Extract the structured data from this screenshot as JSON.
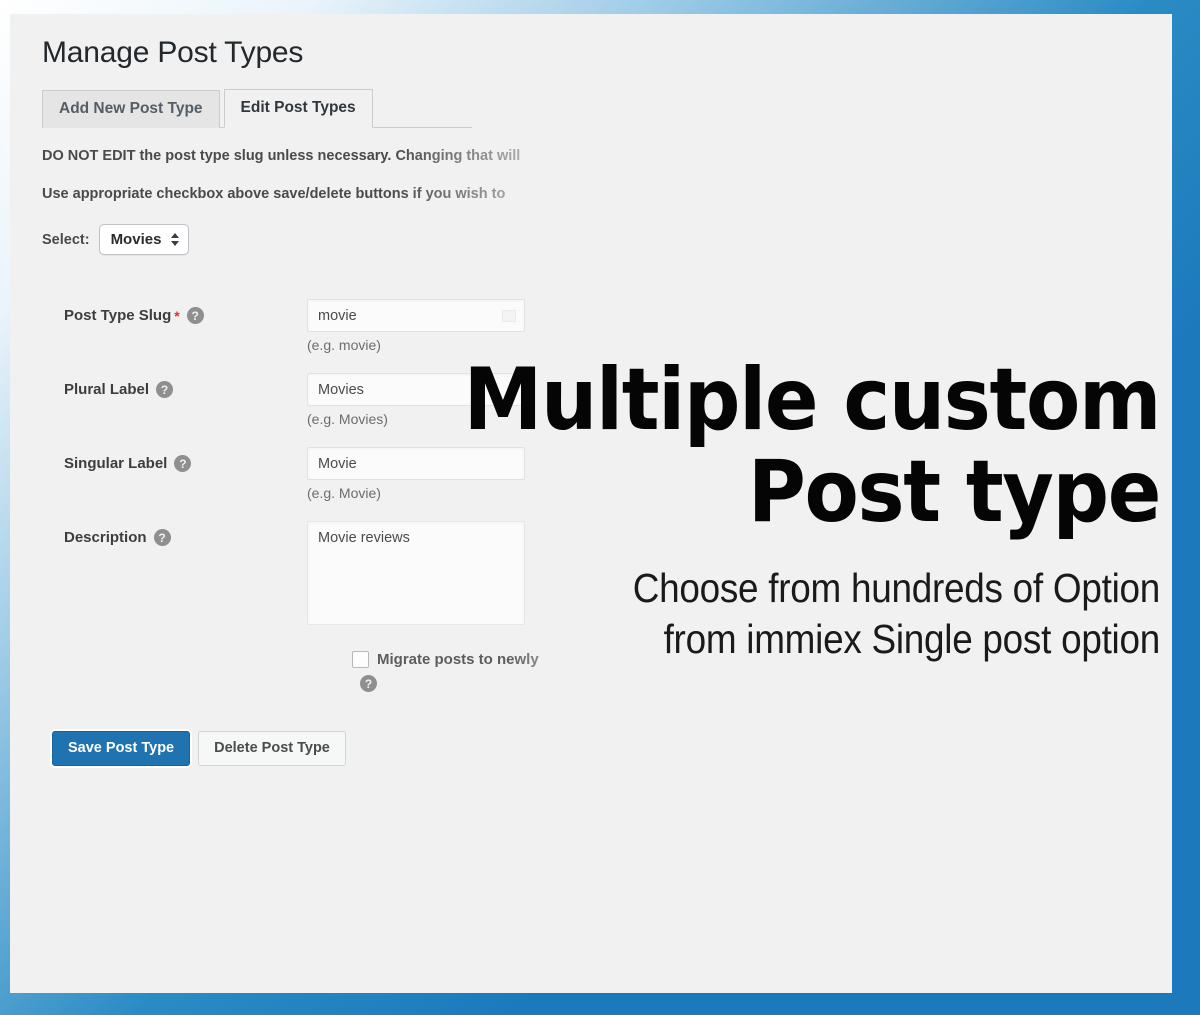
{
  "admin": {
    "page_title": "Manage Post Types",
    "tabs": [
      {
        "label": "Add New Post Type",
        "active": false
      },
      {
        "label": "Edit Post Types",
        "active": true
      }
    ],
    "notices": [
      "DO NOT EDIT the post type slug unless necessary. Changing that will",
      "Use appropriate checkbox above save/delete buttons if you wish to"
    ],
    "select_row": {
      "label": "Select:",
      "value": "Movies",
      "options": [
        "Movies"
      ]
    },
    "fields": [
      {
        "label": "Post Type Slug",
        "required": true,
        "required_marker": "*",
        "help": "?",
        "value": "movie",
        "hint": "(e.g. movie)",
        "type": "text"
      },
      {
        "label": "Plural Label",
        "required": false,
        "help": "?",
        "value": "Movies",
        "hint": "(e.g. Movies)",
        "type": "text"
      },
      {
        "label": "Singular Label",
        "required": false,
        "help": "?",
        "value": "Movie",
        "hint": "(e.g. Movie)",
        "type": "text"
      },
      {
        "label": "Description",
        "required": false,
        "help": "?",
        "value": "Movie reviews",
        "hint": "",
        "type": "textarea"
      }
    ],
    "migrate": {
      "label": "Migrate posts to newly",
      "checked": false,
      "help": "?"
    },
    "buttons": {
      "save": "Save Post Type",
      "delete": "Delete Post Type"
    }
  },
  "marketing": {
    "headline_line_1": "Multiple custom",
    "headline_line_2": "Post type",
    "subline_1": "Choose from hundreds of  Option",
    "subline_2": "from immiex Single post option"
  },
  "colors": {
    "frame_blue": "#1b79bc",
    "primary_button": "#1f73b0",
    "required_star": "#e03030",
    "panel_background": "#f1f1f1"
  }
}
